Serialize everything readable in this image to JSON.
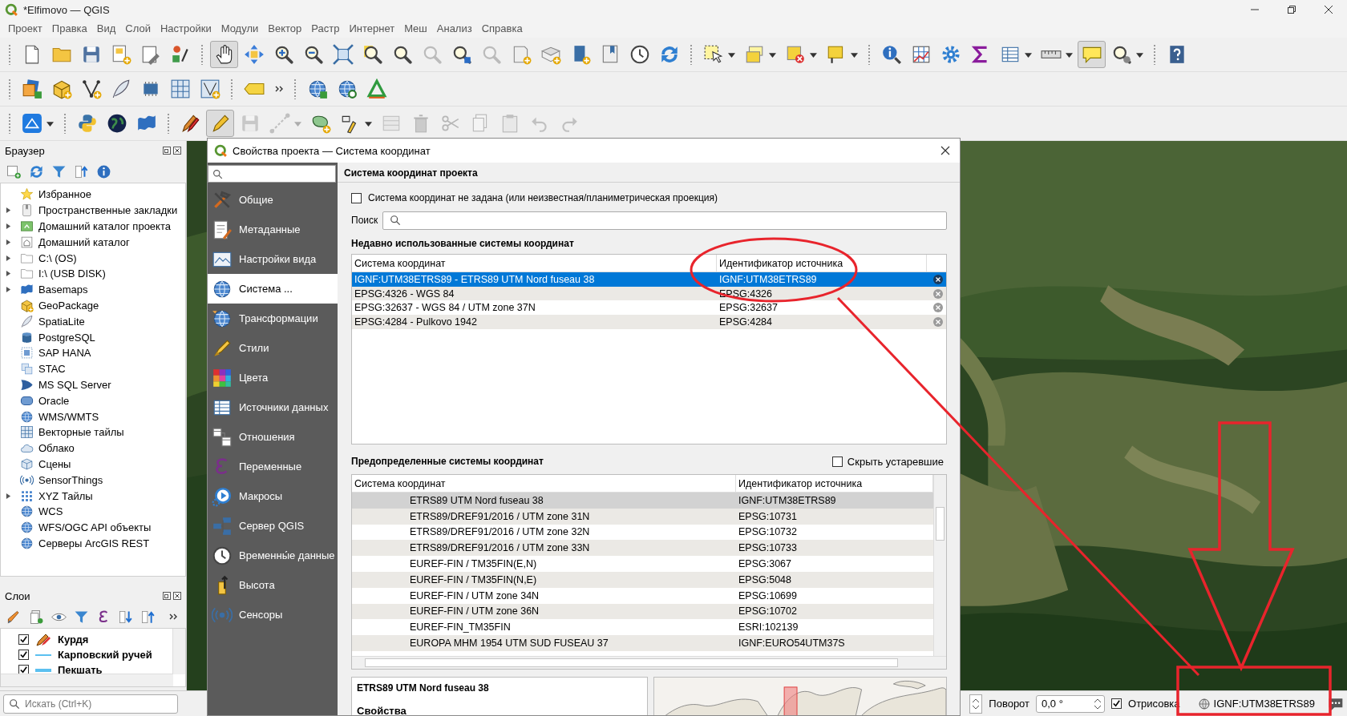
{
  "window": {
    "title": "*Elfimovo — QGIS"
  },
  "menu": [
    "Проект",
    "Правка",
    "Вид",
    "Слой",
    "Настройки",
    "Модули",
    "Вектор",
    "Растр",
    "Интернет",
    "Меш",
    "Анализ",
    "Справка"
  ],
  "toolbars": [
    {
      "groups": [
        {
          "overflow": false,
          "buttons": [
            {
              "pressed": false,
              "disabled": false,
              "dropdown": false
            },
            {
              "pressed": false,
              "disabled": false,
              "dropdown": false
            },
            {
              "pressed": false,
              "disabled": false,
              "dropdown": false
            },
            {
              "pressed": false,
              "disabled": false,
              "dropdown": false
            },
            {
              "pressed": false,
              "disabled": false,
              "dropdown": false
            },
            {
              "pressed": false,
              "disabled": false,
              "dropdown": false
            }
          ]
        },
        {
          "overflow": false,
          "buttons": [
            {
              "pressed": true,
              "disabled": false,
              "dropdown": false
            },
            {
              "pressed": false,
              "disabled": false,
              "dropdown": false
            },
            {
              "pressed": false,
              "disabled": false,
              "dropdown": false
            },
            {
              "pressed": false,
              "disabled": false,
              "dropdown": false
            },
            {
              "pressed": false,
              "disabled": false,
              "dropdown": false
            },
            {
              "pressed": false,
              "disabled": false,
              "dropdown": false
            },
            {
              "pressed": false,
              "disabled": false,
              "dropdown": false
            },
            {
              "pressed": false,
              "disabled": true,
              "dropdown": false
            },
            {
              "pressed": false,
              "disabled": false,
              "dropdown": false
            },
            {
              "pressed": false,
              "disabled": true,
              "dropdown": false
            },
            {
              "pressed": false,
              "disabled": false,
              "dropdown": false
            },
            {
              "pressed": false,
              "disabled": false,
              "dropdown": false
            },
            {
              "pressed": false,
              "disabled": false,
              "dropdown": false
            },
            {
              "pressed": false,
              "disabled": false,
              "dropdown": false
            },
            {
              "pressed": false,
              "disabled": false,
              "dropdown": false
            },
            {
              "pressed": false,
              "disabled": false,
              "dropdown": false
            }
          ]
        },
        {
          "overflow": false,
          "buttons": [
            {
              "pressed": false,
              "disabled": false,
              "dropdown": true
            },
            {
              "pressed": false,
              "disabled": false,
              "dropdown": true
            },
            {
              "pressed": false,
              "disabled": false,
              "dropdown": true
            },
            {
              "pressed": false,
              "disabled": false,
              "dropdown": true
            }
          ]
        },
        {
          "overflow": false,
          "buttons": [
            {
              "pressed": false,
              "disabled": false,
              "dropdown": false
            },
            {
              "pressed": false,
              "disabled": false,
              "dropdown": false
            },
            {
              "pressed": false,
              "disabled": false,
              "dropdown": false
            },
            {
              "pressed": false,
              "disabled": false,
              "dropdown": false
            },
            {
              "pressed": false,
              "disabled": false,
              "dropdown": true
            },
            {
              "pressed": false,
              "disabled": false,
              "dropdown": true
            },
            {
              "pressed": true,
              "disabled": false,
              "dropdown": false
            },
            {
              "pressed": false,
              "disabled": false,
              "dropdown": true
            }
          ]
        },
        {
          "overflow": false,
          "buttons": [
            {
              "pressed": false,
              "disabled": false,
              "dropdown": false
            }
          ]
        }
      ]
    },
    {
      "groups": [
        {
          "overflow": false,
          "buttons": [
            {
              "pressed": false,
              "disabled": false,
              "dropdown": false
            },
            {
              "pressed": false,
              "disabled": false,
              "dropdown": false
            },
            {
              "pressed": false,
              "disabled": false,
              "dropdown": false
            },
            {
              "pressed": false,
              "disabled": false,
              "dropdown": false
            },
            {
              "pressed": false,
              "disabled": false,
              "dropdown": false
            },
            {
              "pressed": false,
              "disabled": false,
              "dropdown": false
            },
            {
              "pressed": false,
              "disabled": false,
              "dropdown": false
            }
          ]
        },
        {
          "overflow": true,
          "buttons": [
            {
              "pressed": false,
              "disabled": false,
              "dropdown": false
            }
          ]
        },
        {
          "overflow": false,
          "buttons": [
            {
              "pressed": false,
              "disabled": false,
              "dropdown": false
            },
            {
              "pressed": false,
              "disabled": false,
              "dropdown": false
            },
            {
              "pressed": false,
              "disabled": false,
              "dropdown": false
            }
          ]
        }
      ]
    },
    {
      "groups": [
        {
          "overflow": false,
          "buttons": [
            {
              "pressed": false,
              "disabled": false,
              "dropdown": true
            }
          ]
        },
        {
          "overflow": false,
          "buttons": [
            {
              "pressed": false,
              "disabled": false,
              "dropdown": false
            },
            {
              "pressed": false,
              "disabled": false,
              "dropdown": false
            },
            {
              "pressed": false,
              "disabled": false,
              "dropdown": false
            }
          ]
        },
        {
          "overflow": false,
          "buttons": [
            {
              "pressed": false,
              "disabled": false,
              "dropdown": false
            },
            {
              "pressed": true,
              "disabled": false,
              "dropdown": false
            },
            {
              "pressed": false,
              "disabled": true,
              "dropdown": false
            },
            {
              "pressed": false,
              "disabled": true,
              "dropdown": true
            },
            {
              "pressed": false,
              "disabled": false,
              "dropdown": false
            },
            {
              "pressed": false,
              "disabled": false,
              "dropdown": true
            },
            {
              "pressed": false,
              "disabled": true,
              "dropdown": false
            },
            {
              "pressed": false,
              "disabled": true,
              "dropdown": false
            },
            {
              "pressed": false,
              "disabled": true,
              "dropdown": false
            },
            {
              "pressed": false,
              "disabled": true,
              "dropdown": false
            },
            {
              "pressed": false,
              "disabled": true,
              "dropdown": false
            },
            {
              "pressed": false,
              "disabled": true,
              "dropdown": false
            },
            {
              "pressed": false,
              "disabled": true,
              "dropdown": false
            }
          ]
        }
      ]
    }
  ],
  "browser": {
    "title": "Браузер",
    "items": [
      {
        "label": "Избранное",
        "expandable": false
      },
      {
        "label": "Пространственные закладки",
        "expandable": true
      },
      {
        "label": "Домашний каталог проекта",
        "expandable": true
      },
      {
        "label": "Домашний каталог",
        "expandable": true
      },
      {
        "label": "C:\\ (OS)",
        "expandable": true
      },
      {
        "label": "I:\\ (USB DISK)",
        "expandable": true
      },
      {
        "label": "Basemaps",
        "expandable": true
      },
      {
        "label": "GeoPackage",
        "expandable": false
      },
      {
        "label": "SpatiaLite",
        "expandable": false
      },
      {
        "label": "PostgreSQL",
        "expandable": false
      },
      {
        "label": "SAP HANA",
        "expandable": false
      },
      {
        "label": "STAC",
        "expandable": false
      },
      {
        "label": "MS SQL Server",
        "expandable": false
      },
      {
        "label": "Oracle",
        "expandable": false
      },
      {
        "label": "WMS/WMTS",
        "expandable": false
      },
      {
        "label": "Векторные тайлы",
        "expandable": false
      },
      {
        "label": "Облако",
        "expandable": false
      },
      {
        "label": "Сцены",
        "expandable": false
      },
      {
        "label": "SensorThings",
        "expandable": false
      },
      {
        "label": "XYZ Тайлы",
        "expandable": true
      },
      {
        "label": "WCS",
        "expandable": false
      },
      {
        "label": "WFS/OGC API объекты",
        "expandable": false
      },
      {
        "label": "Серверы ArcGIS REST",
        "expandable": false
      }
    ]
  },
  "layers": {
    "title": "Слои",
    "items": [
      {
        "label": "Курдя",
        "checked": true,
        "kind": "edit"
      },
      {
        "label": "Карповский ручей",
        "checked": true,
        "kind": "line"
      },
      {
        "label": "Пекшать",
        "checked": true,
        "kind": "thick-line"
      }
    ]
  },
  "locator": {
    "placeholder": "Искать (Ctrl+K)"
  },
  "dialog": {
    "title": "Свойства проекта — Система координат",
    "sidebar": [
      {
        "label": "Общие",
        "selected": false
      },
      {
        "label": "Метаданные",
        "selected": false
      },
      {
        "label": "Настройки вида",
        "selected": false
      },
      {
        "label": "Система ...",
        "selected": true
      },
      {
        "label": "Трансформации",
        "selected": false
      },
      {
        "label": "Стили",
        "selected": false
      },
      {
        "label": "Цвета",
        "selected": false
      },
      {
        "label": "Источники данных",
        "selected": false
      },
      {
        "label": "Отношения",
        "selected": false
      },
      {
        "label": "Переменные",
        "selected": false
      },
      {
        "label": "Макросы",
        "selected": false
      },
      {
        "label": "Сервер QGIS",
        "selected": false
      },
      {
        "label": "Временны́е данные",
        "selected": false
      },
      {
        "label": "Высота",
        "selected": false
      },
      {
        "label": "Сенсоры",
        "selected": false
      }
    ],
    "section_title": "Система координат проекта",
    "no_crs": {
      "label": "Система координат не задана (или неизвестная/планиметрическая проекция)",
      "checked": false
    },
    "search": {
      "label": "Поиск"
    },
    "recent": {
      "title": "Недавно использованные системы координат",
      "columns": [
        "Система координат",
        "Идентификатор источника"
      ],
      "rows": [
        {
          "name": "IGNF:UTM38ETRS89 - ETRS89 UTM Nord fuseau 38",
          "id": "IGNF:UTM38ETRS89",
          "selected": true
        },
        {
          "name": "EPSG:4326 - WGS 84",
          "id": "EPSG:4326",
          "selected": false
        },
        {
          "name": "EPSG:32637 - WGS 84 / UTM zone 37N",
          "id": "EPSG:32637",
          "selected": false
        },
        {
          "name": "EPSG:4284 - Pulkovo 1942",
          "id": "EPSG:4284",
          "selected": false
        }
      ]
    },
    "predefined": {
      "title": "Предопределенные системы координат",
      "hide_deprecated": {
        "label": "Скрыть устаревшие",
        "checked": false
      },
      "columns": [
        "Система координат",
        "Идентификатор источника"
      ],
      "rows": [
        {
          "name": "ETRS89 UTM Nord fuseau 38",
          "id": "IGNF:UTM38ETRS89",
          "selected": true
        },
        {
          "name": "ETRS89/DREF91/2016 / UTM zone 31N",
          "id": "EPSG:10731",
          "selected": false
        },
        {
          "name": "ETRS89/DREF91/2016 / UTM zone 32N",
          "id": "EPSG:10732",
          "selected": false
        },
        {
          "name": "ETRS89/DREF91/2016 / UTM zone 33N",
          "id": "EPSG:10733",
          "selected": false
        },
        {
          "name": "EUREF-FIN / TM35FIN(E,N)",
          "id": "EPSG:3067",
          "selected": false
        },
        {
          "name": "EUREF-FIN / TM35FIN(N,E)",
          "id": "EPSG:5048",
          "selected": false
        },
        {
          "name": "EUREF-FIN / UTM zone 34N",
          "id": "EPSG:10699",
          "selected": false
        },
        {
          "name": "EUREF-FIN / UTM zone 36N",
          "id": "EPSG:10702",
          "selected": false
        },
        {
          "name": "EUREF-FIN_TM35FIN",
          "id": "ESRI:102139",
          "selected": false
        },
        {
          "name": "EUROPA MHM 1954 UTM SUD FUSEAU 37",
          "id": "IGNF:EURO54UTM37S",
          "selected": false
        }
      ]
    },
    "details": {
      "title": "ETRS89 UTM Nord fuseau 38",
      "heading": "Свойства"
    }
  },
  "status_bar": {
    "rotation_label": "Поворот",
    "rotation": "0,0 °",
    "render": {
      "label": "Отрисовка",
      "checked": true
    },
    "crs": "IGNF:UTM38ETRS89"
  }
}
